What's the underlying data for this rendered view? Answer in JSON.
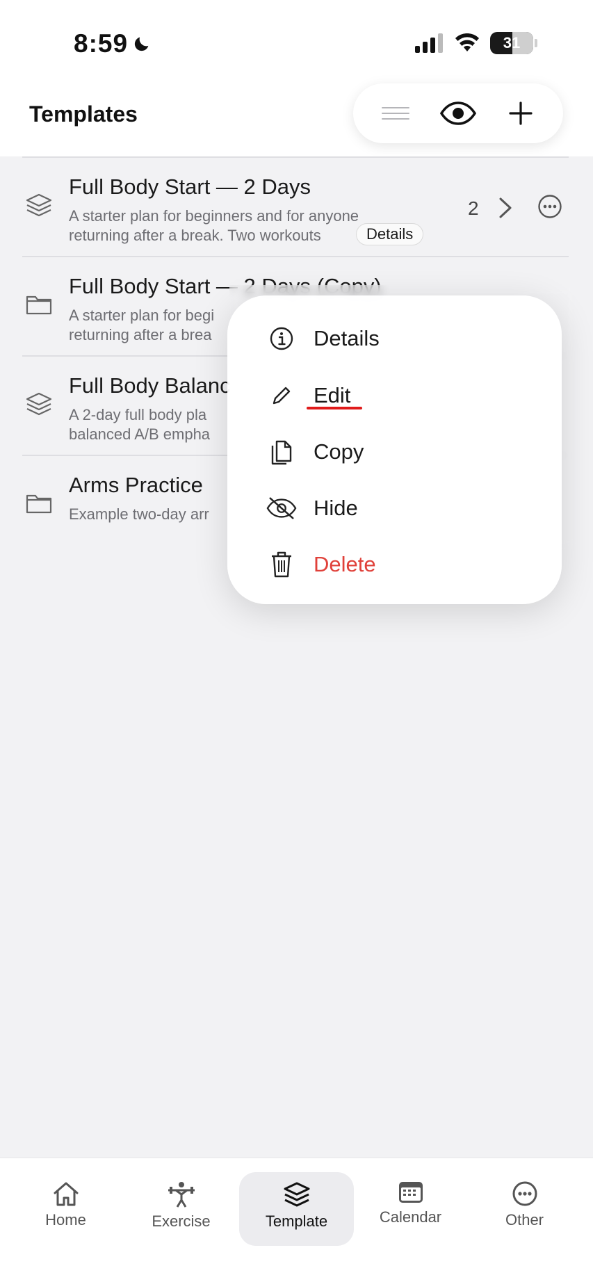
{
  "status": {
    "time": "8:59",
    "battery": "31"
  },
  "header": {
    "title": "Templates"
  },
  "templates": [
    {
      "title": "Full Body Start — 2 Days",
      "desc_line1": "A starter plan for beginners and for anyone",
      "desc_line2": "returning after a break. Two workouts",
      "count": "2",
      "details_label": "Details"
    },
    {
      "title": "Full Body Start — 2 Days (Copy)",
      "desc_line1": "A starter plan for begi",
      "desc_line2": "returning after a brea"
    },
    {
      "title": "Full Body Balanc",
      "desc_line1": "A 2-day full body pla",
      "desc_line2": "balanced A/B empha"
    },
    {
      "title": "Arms Practice",
      "desc_line1": "Example two-day arr"
    }
  ],
  "context_menu": {
    "items": [
      {
        "label": "Details",
        "icon": "info-icon"
      },
      {
        "label": "Edit",
        "icon": "pencil-icon"
      },
      {
        "label": "Copy",
        "icon": "copy-icon"
      },
      {
        "label": "Hide",
        "icon": "eye-slash-icon"
      },
      {
        "label": "Delete",
        "icon": "trash-icon",
        "color": "#e0413a"
      }
    ]
  },
  "tabbar": {
    "tabs": [
      {
        "label": "Home",
        "icon": "house-icon"
      },
      {
        "label": "Exercise",
        "icon": "weightlifter-icon"
      },
      {
        "label": "Template",
        "icon": "layers-icon",
        "active": true
      },
      {
        "label": "Calendar",
        "icon": "calendar-icon"
      },
      {
        "label": "Other",
        "icon": "ellipsis-circle-icon"
      }
    ]
  },
  "colors": {
    "danger": "#e0413a",
    "annotation": "#e01b1b",
    "background": "#f2f2f4"
  }
}
